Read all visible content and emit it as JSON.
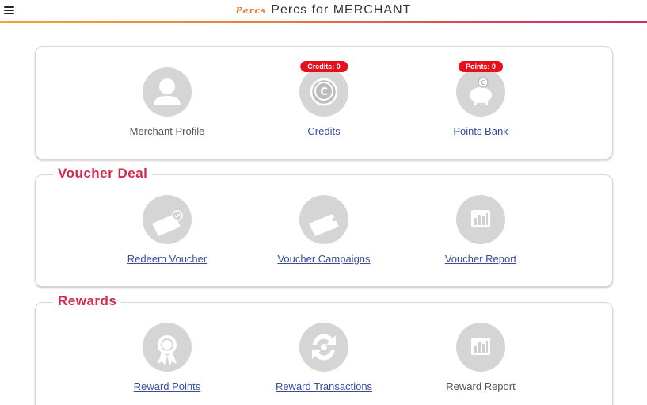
{
  "header": {
    "logo_text": "Percs",
    "title": "Percs for MERCHANT",
    "accent_colors": [
      "#f2a23a",
      "#d6284f"
    ]
  },
  "account": {
    "merchant_profile": "Merchant Profile",
    "credits": {
      "label": "Credits",
      "badge": "Credits: 0"
    },
    "points_bank": {
      "label": "Points Bank",
      "badge": "Points: 0"
    }
  },
  "voucher_deal": {
    "title": "Voucher Deal",
    "redeem": "Redeem Voucher",
    "campaigns": "Voucher Campaigns",
    "report": "Voucher Report"
  },
  "rewards": {
    "title": "Rewards",
    "points": "Reward Points",
    "transactions": "Reward Transactions",
    "report": "Reward Report"
  },
  "icons": {
    "merchant_profile": "person-icon",
    "credits": "coin-icon",
    "points_bank": "piggy-bank-icon",
    "redeem_voucher": "voucher-tag-check-icon",
    "voucher_campaigns": "voucher-tag-icon",
    "voucher_report": "bar-chart-icon",
    "reward_points": "award-ribbon-icon",
    "reward_transactions": "exchange-icon",
    "reward_report": "bar-chart-icon"
  }
}
